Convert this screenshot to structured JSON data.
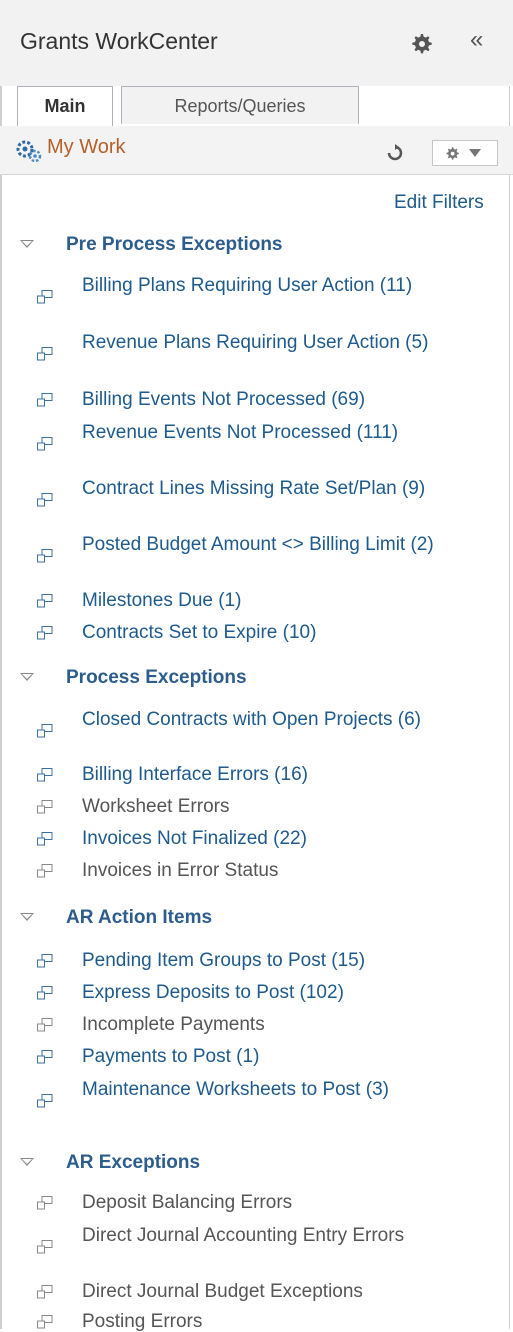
{
  "header": {
    "title": "Grants WorkCenter"
  },
  "tabs": [
    {
      "label": "Main"
    },
    {
      "label": "Reports/Queries"
    }
  ],
  "my_work": {
    "label": "My Work",
    "edit_filters": "Edit Filters"
  },
  "sections": [
    {
      "title": "Pre Process Exceptions"
    },
    {
      "title": "Process Exceptions"
    },
    {
      "title": "AR Action Items"
    },
    {
      "title": "AR Exceptions"
    }
  ],
  "items": [
    {
      "label": "Billing Plans Requiring User Action (11)"
    },
    {
      "label": "Revenue Plans Requiring User Action (5)"
    },
    {
      "label": "Billing Events Not Processed (69)"
    },
    {
      "label": "Revenue Events Not Processed (111)"
    },
    {
      "label": "Contract Lines Missing Rate Set/Plan (9)"
    },
    {
      "label": "Posted Budget Amount <> Billing Limit (2)"
    },
    {
      "label": "Milestones Due (1)"
    },
    {
      "label": "Contracts Set to Expire (10)"
    },
    {
      "label": "Closed Contracts with Open Projects (6)"
    },
    {
      "label": "Billing Interface Errors (16)"
    },
    {
      "label": "Worksheet Errors"
    },
    {
      "label": "Invoices Not Finalized (22)"
    },
    {
      "label": "Invoices in Error Status"
    },
    {
      "label": "Pending Item Groups to Post (15)"
    },
    {
      "label": "Express Deposits to Post (102)"
    },
    {
      "label": "Incomplete Payments"
    },
    {
      "label": "Payments to Post (1)"
    },
    {
      "label": "Maintenance Worksheets to Post (3)"
    },
    {
      "label": "Deposit Balancing Errors"
    },
    {
      "label": "Direct Journal Accounting Entry Errors"
    },
    {
      "label": "Direct Journal Budget Exceptions"
    },
    {
      "label": "Posting Errors"
    }
  ],
  "colors": {
    "link": "#1e5a8c",
    "section": "#2c5d8c",
    "my_work": "#b5612a"
  }
}
